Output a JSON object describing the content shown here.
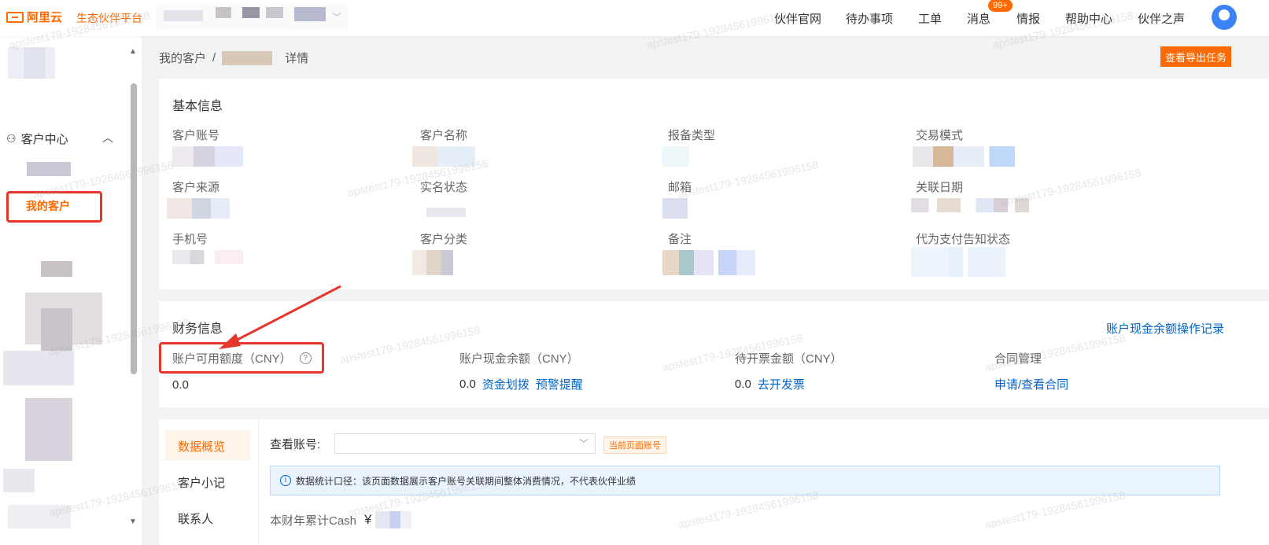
{
  "header": {
    "logo_text": "阿里云",
    "platform_name": "生态伙伴平台",
    "nav": [
      "伙伴官网",
      "待办事项",
      "工单",
      "消息",
      "情报",
      "帮助中心",
      "伙伴之声"
    ],
    "message_badge": "99+"
  },
  "sidebar": {
    "group_label": "客户中心",
    "active_item": "我的客户"
  },
  "breadcrumb": {
    "root": "我的客户",
    "separator": "/",
    "suffix": "详情"
  },
  "export_button": "查看导出任务",
  "basic_info": {
    "title": "基本信息",
    "fields": [
      "客户账号",
      "客户名称",
      "报备类型",
      "交易模式",
      "客户来源",
      "实名状态",
      "邮箱",
      "关联日期",
      "手机号",
      "客户分类",
      "备注",
      "代为支付告知状态"
    ]
  },
  "finance": {
    "title": "财务信息",
    "balance_log_link": "账户现金余额操作记录",
    "available_label": "账户可用额度（CNY）",
    "available_value": "0.0",
    "cash_label": "账户现金余额（CNY）",
    "cash_value": "0.0",
    "transfer_link": "资金划拨",
    "alert_link": "预警提醒",
    "invoice_label": "待开票金额（CNY）",
    "invoice_value": "0.0",
    "invoice_link": "去开发票",
    "contract_label": "合同管理",
    "contract_link": "申请/查看合同"
  },
  "detail_tabs": [
    "数据概览",
    "客户小记",
    "联系人"
  ],
  "overview": {
    "view_account_label": "查看账号:",
    "current_tag": "当前页面账号",
    "info_text": "数据统计口径：该页面数据展示客户账号关联期间整体消费情况，不代表伙伴业绩",
    "cash_label": "本财年累计Cash",
    "currency": "¥"
  },
  "watermark": "apstest179-19284561996158",
  "colors": {
    "brand": "#ff6a00",
    "link": "#0064c8",
    "highlight": "#e5372c"
  }
}
